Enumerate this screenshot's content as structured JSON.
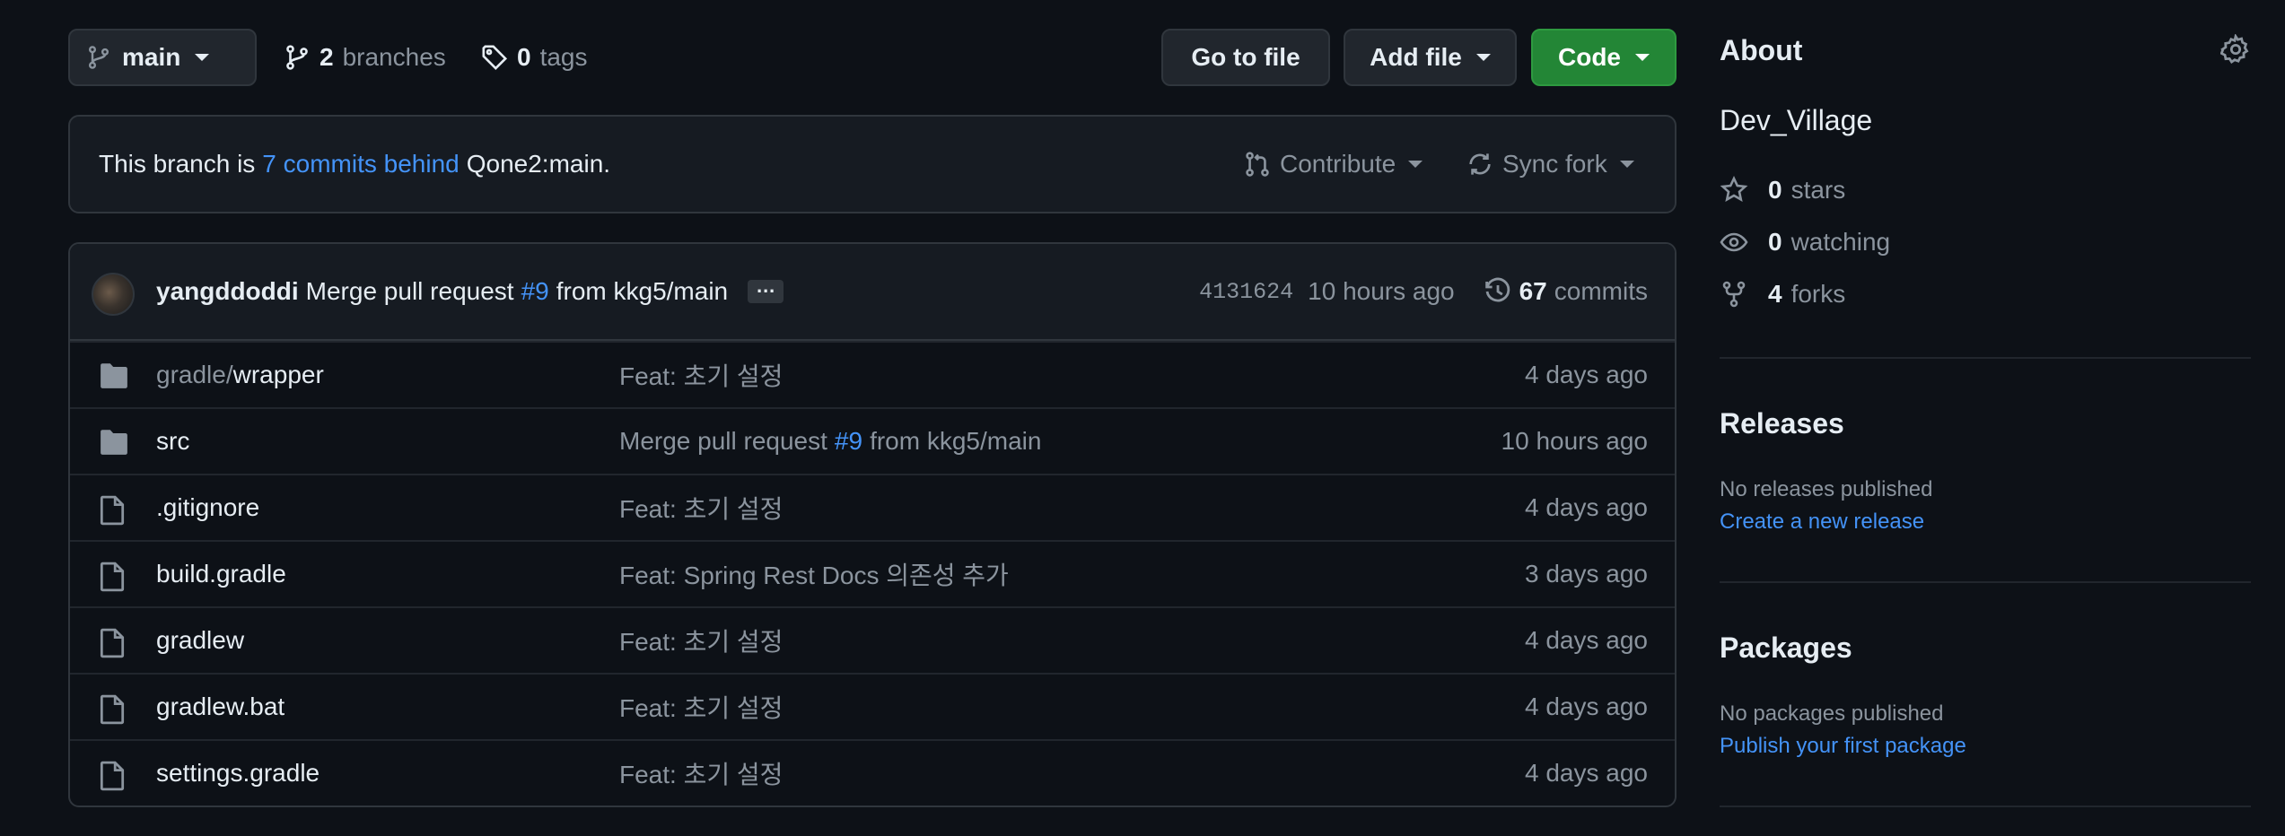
{
  "toolbar": {
    "branch": "main",
    "branches_count": "2",
    "branches_label": "branches",
    "tags_count": "0",
    "tags_label": "tags",
    "goto_file": "Go to file",
    "add_file": "Add file",
    "code": "Code"
  },
  "status": {
    "prefix": "This branch is",
    "link": "7 commits behind",
    "suffix": "Qone2:main.",
    "contribute": "Contribute",
    "sync": "Sync fork"
  },
  "commit": {
    "author": "yangddoddi",
    "message_pre": "Merge pull request",
    "pr": "#9",
    "message_post": "from kkg5/main",
    "ellipsis": "…",
    "sha": "4131624",
    "time": "10 hours ago",
    "commits_count": "67",
    "commits_label": "commits"
  },
  "files": [
    {
      "type": "folder",
      "name_dim": "gradle/",
      "name": "wrapper",
      "msg": "Feat: 초기 설정",
      "msg_link": "",
      "msg_post": "",
      "age": "4 days ago"
    },
    {
      "type": "folder",
      "name_dim": "",
      "name": "src",
      "msg": "Merge pull request",
      "msg_link": "#9",
      "msg_post": "from kkg5/main",
      "age": "10 hours ago"
    },
    {
      "type": "file",
      "name_dim": "",
      "name": ".gitignore",
      "msg": "Feat: 초기 설정",
      "msg_link": "",
      "msg_post": "",
      "age": "4 days ago"
    },
    {
      "type": "file",
      "name_dim": "",
      "name": "build.gradle",
      "msg": "Feat: Spring Rest Docs 의존성 추가",
      "msg_link": "",
      "msg_post": "",
      "age": "3 days ago"
    },
    {
      "type": "file",
      "name_dim": "",
      "name": "gradlew",
      "msg": "Feat: 초기 설정",
      "msg_link": "",
      "msg_post": "",
      "age": "4 days ago"
    },
    {
      "type": "file",
      "name_dim": "",
      "name": "gradlew.bat",
      "msg": "Feat: 초기 설정",
      "msg_link": "",
      "msg_post": "",
      "age": "4 days ago"
    },
    {
      "type": "file",
      "name_dim": "",
      "name": "settings.gradle",
      "msg": "Feat: 초기 설정",
      "msg_link": "",
      "msg_post": "",
      "age": "4 days ago"
    }
  ],
  "sidebar": {
    "about_title": "About",
    "description": "Dev_Village",
    "stars_count": "0",
    "stars_label": "stars",
    "watching_count": "0",
    "watching_label": "watching",
    "forks_count": "4",
    "forks_label": "forks",
    "releases_title": "Releases",
    "releases_none": "No releases published",
    "releases_link": "Create a new release",
    "packages_title": "Packages",
    "packages_none": "No packages published",
    "packages_link": "Publish your first package"
  },
  "colors": {
    "background": "#0d1117",
    "link": "#4493f8",
    "code_button": "#238636"
  }
}
